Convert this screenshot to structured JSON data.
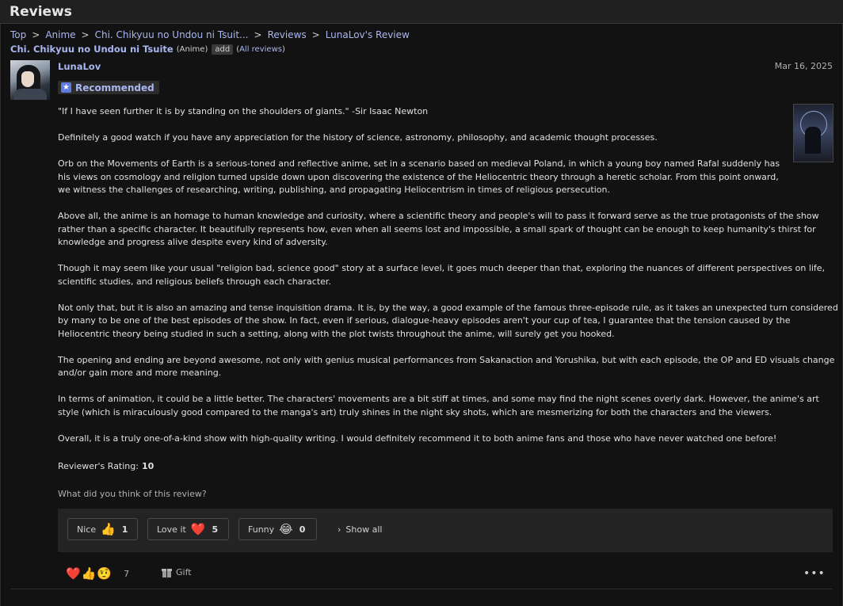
{
  "header": {
    "title": "Reviews"
  },
  "breadcrumb": {
    "items": [
      "Top",
      "Anime",
      "Chi. Chikyuu no Undou ni Tsuit...",
      "Reviews",
      "LunaLov's Review"
    ],
    "separator": ">"
  },
  "subject": {
    "title": "Chi. Chikyuu no Undou ni Tsuite",
    "type": "(Anime)",
    "add_label": "add",
    "all_reviews_prefix": "(",
    "all_reviews_link": "All reviews",
    "all_reviews_suffix": ")"
  },
  "review": {
    "username": "LunaLov",
    "date": "Mar 16, 2025",
    "tag_label": "Recommended",
    "tag_icon": "star-icon",
    "paragraphs": [
      "\"If I have seen further it is by standing on the shoulders of giants.\" -Sir Isaac Newton",
      "Definitely a good watch if you have any appreciation for the history of science, astronomy, philosophy, and academic thought processes.",
      "Orb on the Movements of Earth is a serious-toned and reflective anime, set in a scenario based on medieval Poland, in which a young boy named Rafal suddenly has his views on cosmology and religion turned upside down upon discovering the existence of the Heliocentric theory through a heretic scholar. From this point onward, we witness the challenges of researching, writing, publishing, and propagating Heliocentrism in times of religious persecution.",
      "Above all, the anime is an homage to human knowledge and curiosity, where a scientific theory and people's will to pass it forward serve as the true protagonists of the show rather than a specific character. It beautifully represents how, even when all seems lost and impossible, a small spark of thought can be enough to keep humanity's thirst for knowledge and progress alive despite every kind of adversity.",
      "Though it may seem like your usual \"religion bad, science good\" story at a surface level, it goes much deeper than that, exploring the nuances of different perspectives on life, scientific studies, and religious beliefs through each character.",
      "Not only that, but it is also an amazing and tense inquisition drama. It is, by the way, a good example of the famous three-episode rule, as it takes an unexpected turn considered by many to be one of the best episodes of the show. In fact, even if serious, dialogue-heavy episodes aren't your cup of tea, I guarantee that the tension caused by the Heliocentric theory being studied in such a setting, along with the plot twists throughout the anime, will surely get you hooked.",
      "The opening and ending are beyond awesome, not only with genius musical performances from Sakanaction and Yorushika, but with each episode, the OP and ED visuals change and/or gain more and more meaning.",
      "In terms of animation, it could be a little better. The characters' movements are a bit stiff at times, and some may find the night scenes overly dark. However, the anime's art style (which is miraculously good compared to the manga's art) truly shines in the night sky shots, which are mesmerizing for both the characters and the viewers.",
      "Overall, it is a truly one-of-a-kind show with high-quality writing. I would definitely recommend it to both anime fans and those who have never watched one before!"
    ],
    "rating_label": "Reviewer's Rating:",
    "rating_value": "10",
    "question": "What did you think of this review?"
  },
  "reactions": {
    "buttons": [
      {
        "label": "Nice",
        "emoji": "👍",
        "count": "1"
      },
      {
        "label": "Love it",
        "emoji": "❤️",
        "count": "5"
      },
      {
        "label": "Funny",
        "emoji": "😂",
        "count": "0"
      }
    ],
    "show_all_label": "Show all"
  },
  "footer": {
    "summary_emojis": [
      "❤️",
      "👍",
      "🤨"
    ],
    "summary_count": "7",
    "gift_label": "Gift",
    "more_label": "•••"
  },
  "colors": {
    "background": "#121212",
    "link": "#a9b7f0",
    "accent": "#5e7be0",
    "panel": "#242424"
  }
}
